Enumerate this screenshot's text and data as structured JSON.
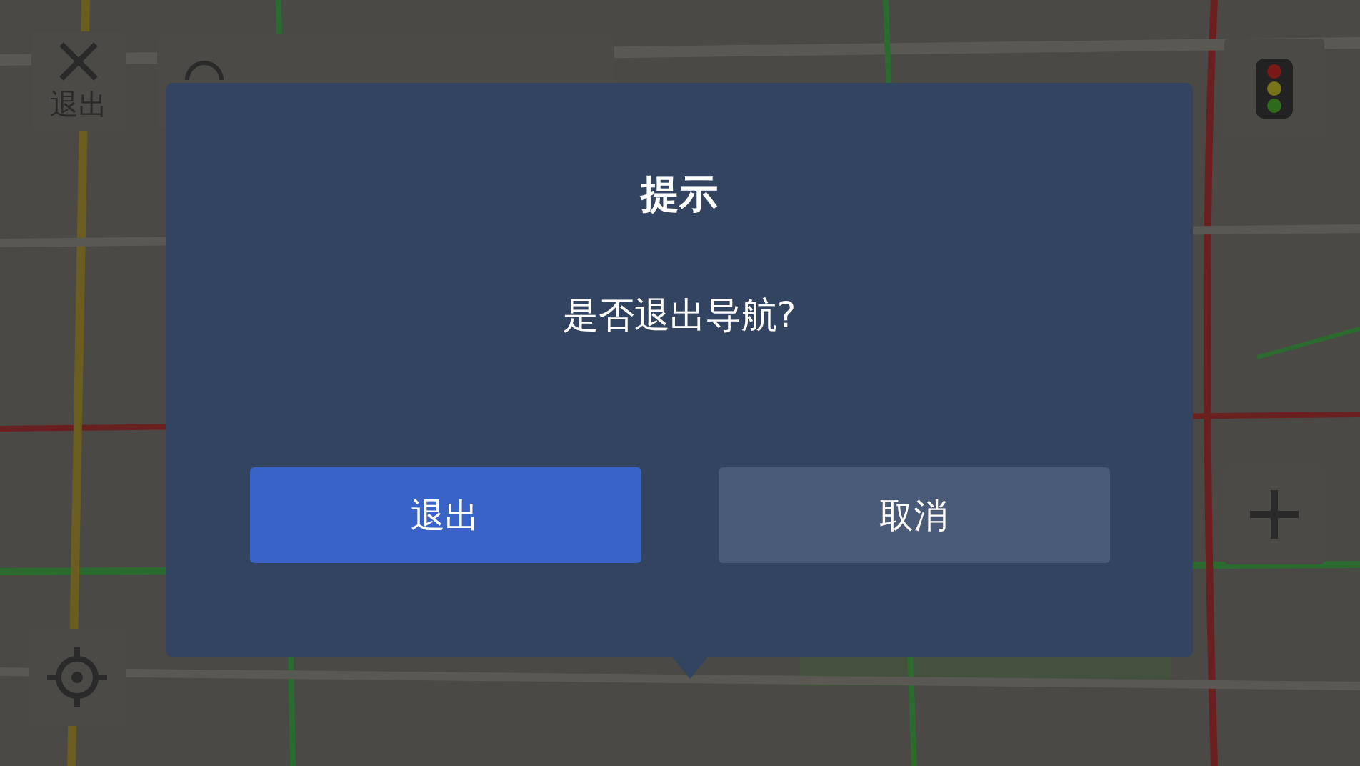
{
  "exit_button": {
    "label": "退出"
  },
  "dialog": {
    "title": "提示",
    "message": "是否退出导航?",
    "buttons": [
      {
        "label": "退出",
        "kind": "primary"
      },
      {
        "label": "取消",
        "kind": "secondary"
      }
    ]
  }
}
